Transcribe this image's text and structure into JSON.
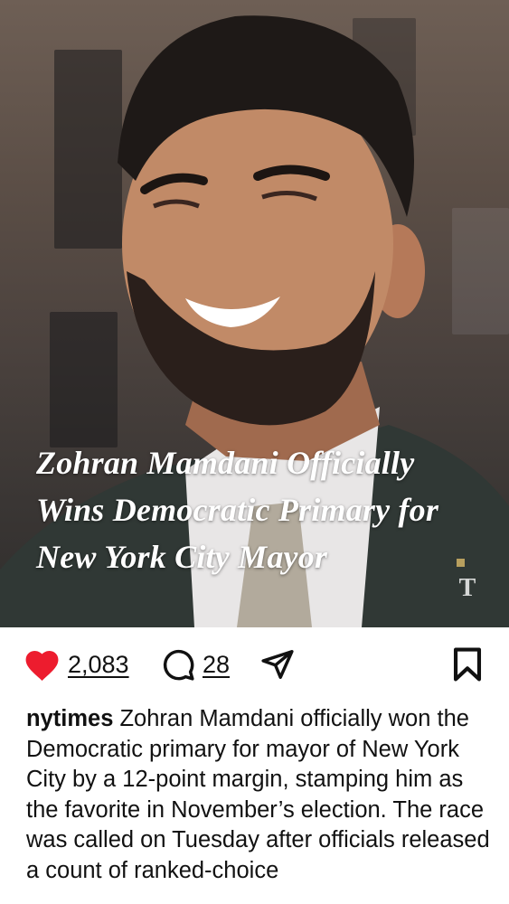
{
  "post": {
    "image_alt": "Portrait of Zohran Mamdani smiling",
    "headline": "Zohran Mamdani Officially Wins Democratic Primary for New York City Mayor",
    "watermark": "T"
  },
  "actions": {
    "like_count": "2,083",
    "comment_count": "28",
    "icons": [
      "heart-icon",
      "comment-icon",
      "share-icon",
      "bookmark-icon"
    ],
    "like_color": "#ed1c2e"
  },
  "caption": {
    "username": "nytimes",
    "text": "Zohran Mamdani officially won the Democratic primary for mayor of New York City by a 12-point margin, stamping him as the favorite in November’s election. The race was called on Tuesday after officials released a count of ranked-choice"
  }
}
